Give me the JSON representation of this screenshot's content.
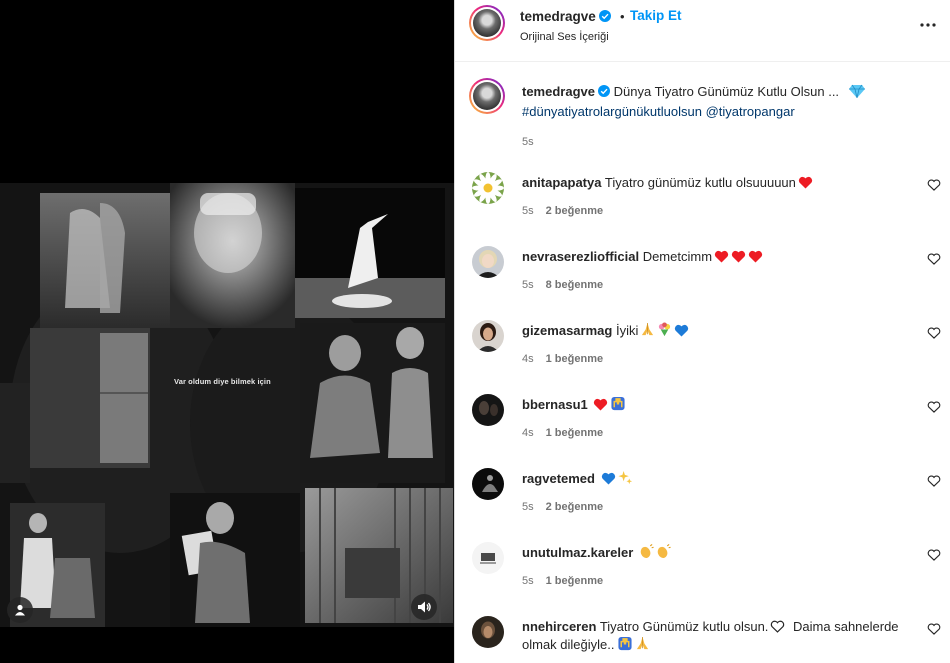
{
  "post": {
    "username": "temedragve",
    "follow_label": "Takip Et",
    "dot": "•",
    "audio_label": "Orijinal Ses İçeriği",
    "overlay_text": "Var oldum diye bilmek için"
  },
  "caption": {
    "username": "temedragve",
    "text": "Dünya Tiyatro Günümüz Kutlu Olsun ...",
    "emoji": "gem-emoji",
    "line2": "#dünyatiyatrolargünükutluolsun @tiyatropangar",
    "time": "5s"
  },
  "comments": [
    {
      "username": "anitapapatya",
      "text": "Tiyatro günümüz kutlu olsuuuuun",
      "emojis": [
        "red-heart"
      ],
      "time": "5s",
      "likes": "2 beğenme",
      "avatar": "daisy"
    },
    {
      "username": "nevraserezliofficial",
      "text": "Demetcimm",
      "emojis": [
        "red-heart",
        "red-heart",
        "red-heart"
      ],
      "time": "5s",
      "likes": "8 beğenme",
      "avatar": "woman-blonde"
    },
    {
      "username": "gizemasarmag",
      "text": "İyiki",
      "emojis": [
        "folded-hands",
        "bouquet",
        "blue-heart"
      ],
      "time": "4s",
      "likes": "1 beğenme",
      "avatar": "woman-dark"
    },
    {
      "username": "bbernasu1",
      "text": "",
      "emojis": [
        "red-heart",
        "raised-hands"
      ],
      "time": "4s",
      "likes": "1 beğenme",
      "avatar": "dark-photo"
    },
    {
      "username": "ragvetemed",
      "text": "",
      "emojis": [
        "blue-heart",
        "sparkles"
      ],
      "time": "5s",
      "likes": "2 beğenme",
      "avatar": "silhouette"
    },
    {
      "username": "unutulmaz.kareler",
      "text": "",
      "emojis": [
        "clapping-hands",
        "clapping-hands"
      ],
      "time": "5s",
      "likes": "1 beğenme",
      "avatar": "logo-light"
    },
    {
      "username": "nnehirceren",
      "text": "Tiyatro Günümüz kutlu olsun.",
      "emojis": [
        "outline-heart"
      ],
      "text2": "Daima sahnelerde olmak dileğiyle..",
      "emojis2": [
        "raised-hands",
        "folded-hands"
      ],
      "time": "",
      "likes": "",
      "avatar": "woman-portrait"
    }
  ],
  "colors": {
    "link": "#0095f6",
    "hashtag": "#00376b",
    "muted": "#737373",
    "heart": "#ed1c24",
    "blue_heart": "#1d7bd8"
  }
}
